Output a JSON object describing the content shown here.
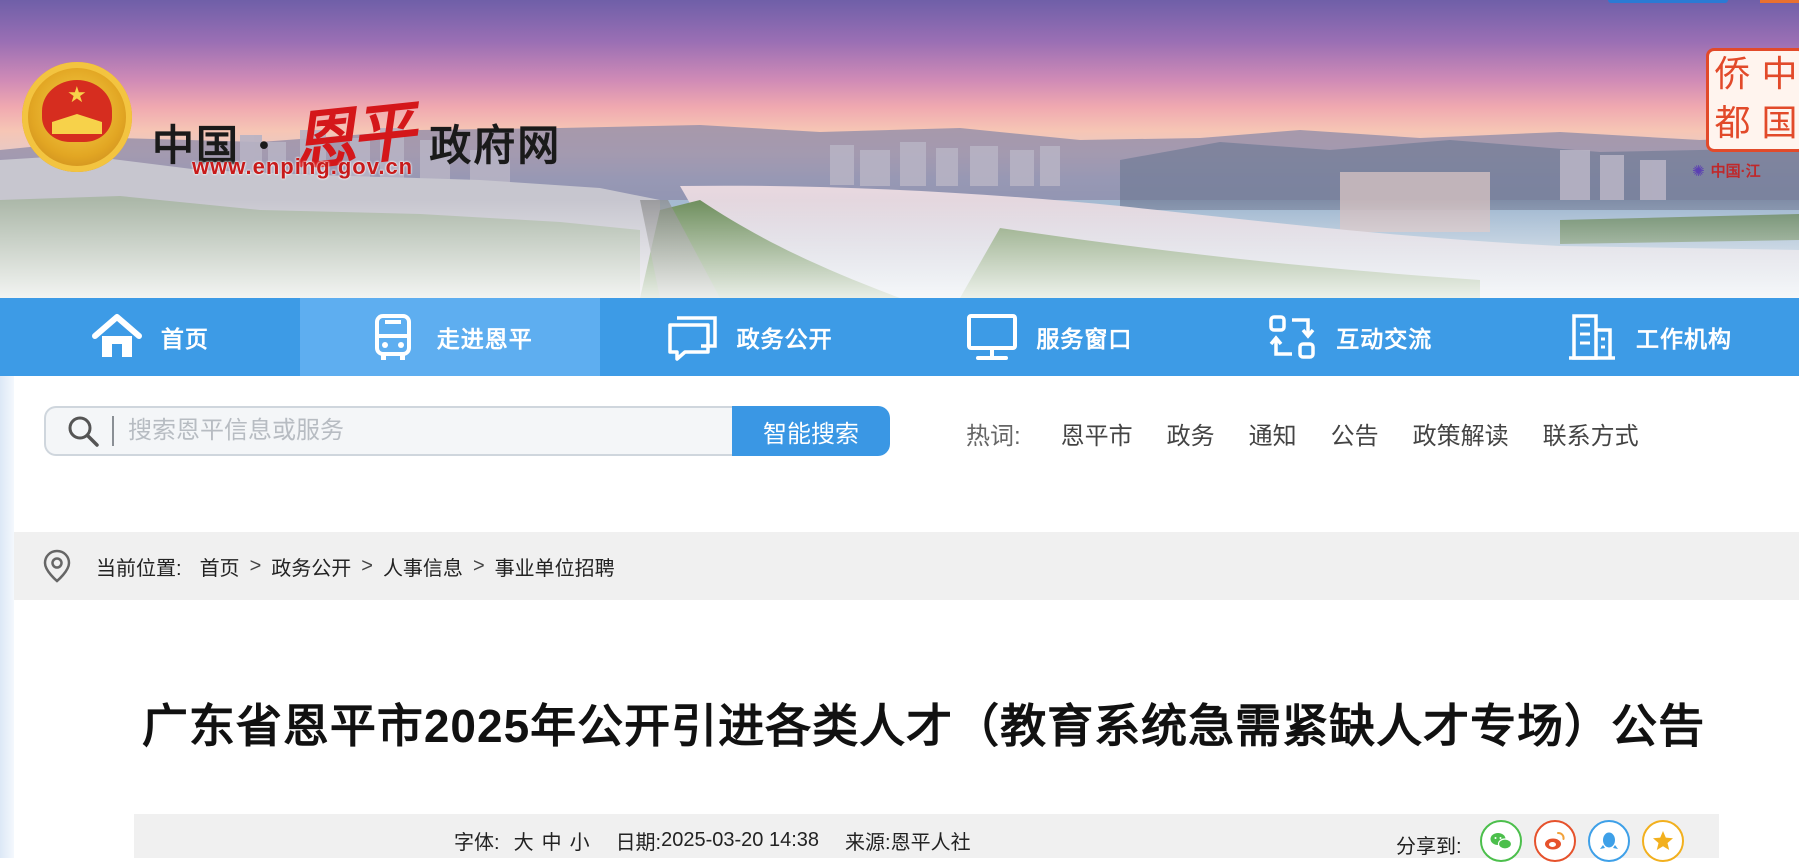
{
  "header": {
    "site_title_left": "中国 ·",
    "site_title_callig": "恩平",
    "site_title_right": "政府网",
    "site_url": "www.enping.gov.cn",
    "badge_chars": [
      "侨",
      "中",
      "都",
      "国"
    ],
    "badge_subtitle": "中国·江"
  },
  "nav": {
    "items": [
      {
        "label": "首页",
        "icon": "home-icon"
      },
      {
        "label": "走进恩平",
        "icon": "bus-icon"
      },
      {
        "label": "政务公开",
        "icon": "chat-icon"
      },
      {
        "label": "服务窗口",
        "icon": "monitor-icon"
      },
      {
        "label": "互动交流",
        "icon": "exchange-icon"
      },
      {
        "label": "工作机构",
        "icon": "building-icon"
      }
    ],
    "active_index": 1
  },
  "search": {
    "placeholder": "搜索恩平信息或服务",
    "button_label": "智能搜索"
  },
  "hot_words": {
    "label": "热词:",
    "items": [
      "恩平市",
      "政务",
      "通知",
      "公告",
      "政策解读",
      "联系方式"
    ]
  },
  "breadcrumb": {
    "label": "当前位置:",
    "items": [
      "首页",
      "政务公开",
      "人事信息",
      "事业单位招聘"
    ],
    "separator": ">"
  },
  "article": {
    "title": "广东省恩平市2025年公开引进各类人才（教育系统急需紧缺人才专场）公告"
  },
  "meta": {
    "font_label": "字体:",
    "font_sizes": [
      "大",
      "中",
      "小"
    ],
    "date_label": "日期:",
    "date_value": "2025-03-20 14:38",
    "source_label": "来源:",
    "source_value": "恩平人社",
    "share_label": "分享到:"
  },
  "colors": {
    "nav_bg": "#3d9be6",
    "nav_active": "#5eaef0",
    "search_btn": "#3a97e4",
    "wechat": "#4cbf4c",
    "weibo": "#e6522c",
    "qq": "#3ea0e8",
    "qzone": "#f2b01e"
  }
}
